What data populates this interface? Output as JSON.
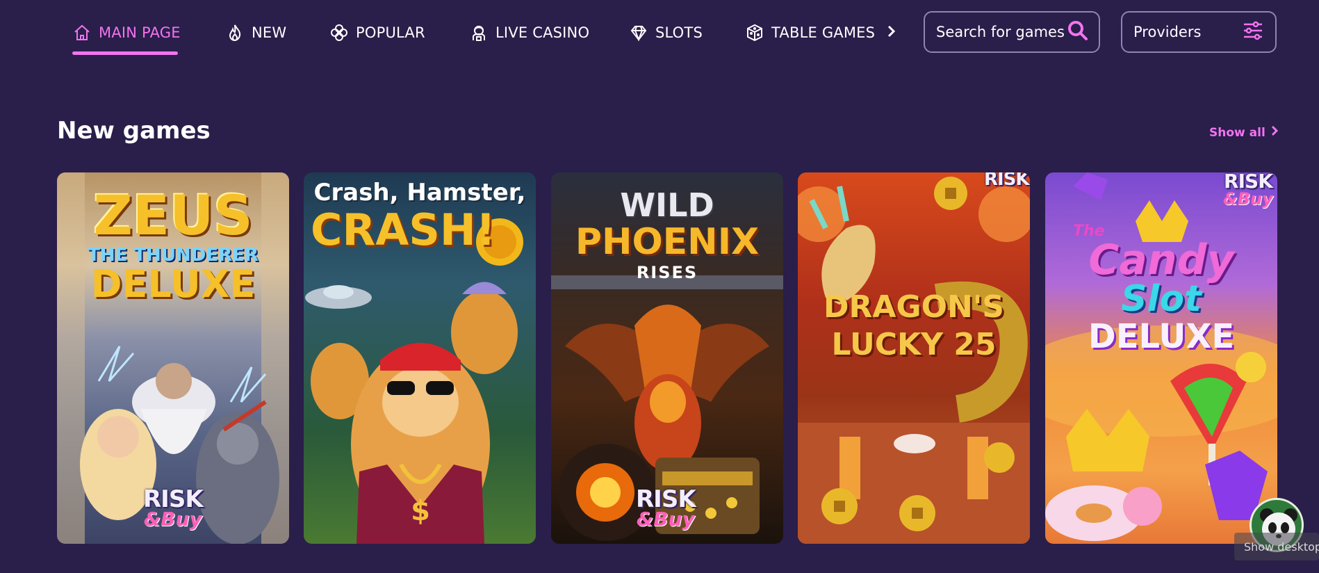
{
  "nav": {
    "items": [
      {
        "label": "MAIN PAGE",
        "icon": "home-icon",
        "active": true
      },
      {
        "label": "NEW",
        "icon": "flame-icon",
        "active": false
      },
      {
        "label": "POPULAR",
        "icon": "clover-icon",
        "active": false
      },
      {
        "label": "LIVE CASINO",
        "icon": "dealer-icon",
        "active": false
      },
      {
        "label": "SLOTS",
        "icon": "diamond-icon",
        "active": false
      },
      {
        "label": "TABLE GAMES",
        "icon": "dice-icon",
        "active": false
      }
    ],
    "more_icon": "chevron-right-icon",
    "search": {
      "placeholder": "Search for games",
      "icon": "search-icon"
    },
    "providers": {
      "label": "Providers",
      "icon": "sliders-icon"
    }
  },
  "section": {
    "title": "New games",
    "show_all": "Show all"
  },
  "games": [
    {
      "title_lines": [
        "ZEUS",
        "THE THUNDERER",
        "DELUXE"
      ],
      "badge": [
        "RISK",
        "&Buy"
      ]
    },
    {
      "title_lines": [
        "Crash, Hamster,",
        "CRASH!"
      ],
      "badge": []
    },
    {
      "title_lines": [
        "WILD",
        "PHOENIX",
        "RISES"
      ],
      "badge": [
        "RISK",
        "&Buy"
      ]
    },
    {
      "title_lines": [
        "DRAGON'S",
        "LUCKY 25"
      ],
      "badge": [
        "RISK"
      ]
    },
    {
      "title_lines": [
        "The",
        "Candy",
        "Slot",
        "DELUXE"
      ],
      "badge": [
        "RISK",
        "&Buy"
      ]
    }
  ],
  "taskbar": {
    "show_desktop": "Show desktop"
  },
  "colors": {
    "background": "#2a1e4a",
    "accent": "#f274f0",
    "border": "#8f84b4"
  }
}
